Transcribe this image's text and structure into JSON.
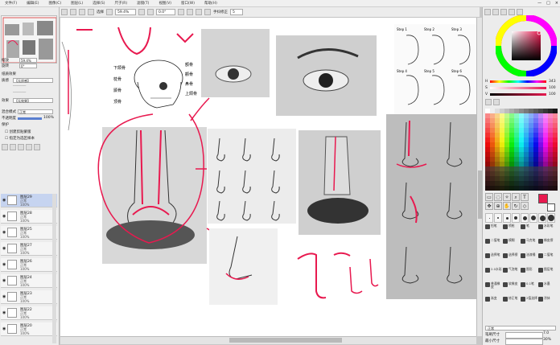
{
  "menu": [
    "文件(F)",
    "编辑(E)",
    "图像(C)",
    "图层(L)",
    "选择(S)",
    "尺子(R)",
    "滤镜(T)",
    "视图(V)",
    "窗口(W)",
    "帮助(H)"
  ],
  "window_controls": [
    "—",
    "□",
    "×"
  ],
  "toolbar": {
    "select_label": "选择",
    "zoom_value": "59.4%",
    "angle_value": "0.0°",
    "stabilizer_label": "手抖修正",
    "stabilizer_value": "5"
  },
  "navigator": {
    "zoom_label": "缩放",
    "zoom_value": "59.4%",
    "rotate_label": "旋转",
    "rotate_value": "0°"
  },
  "layer_props": {
    "section_label": "纸质效果",
    "texture_label": "质感",
    "texture_value": "【无质感】",
    "effect_label": "效果",
    "effect_value": "【无效果】",
    "blend_label": "混合模式",
    "blend_value": "正常",
    "opacity_label": "不透明度",
    "opacity_value": "100%",
    "protect_label": "保护",
    "clip_label": "创建剪贴蒙版",
    "ref_label": "指定为选区样本"
  },
  "layers": [
    {
      "name": "图层29",
      "mode": "正常",
      "opacity": "100%",
      "selected": true
    },
    {
      "name": "图层28",
      "mode": "正常",
      "opacity": "100%",
      "selected": false
    },
    {
      "name": "图层25",
      "mode": "正常",
      "opacity": "100%",
      "selected": false
    },
    {
      "name": "图层27",
      "mode": "正常",
      "opacity": "100%",
      "selected": false
    },
    {
      "name": "图层26",
      "mode": "正常",
      "opacity": "100%",
      "selected": false
    },
    {
      "name": "图层24",
      "mode": "正常",
      "opacity": "100%",
      "selected": false
    },
    {
      "name": "图层23",
      "mode": "正常",
      "opacity": "100%",
      "selected": false
    },
    {
      "name": "图层22",
      "mode": "正常",
      "opacity": "100%",
      "selected": false
    },
    {
      "name": "图层20",
      "mode": "正常",
      "opacity": "100%",
      "selected": false
    }
  ],
  "color": {
    "h_label": "H",
    "h_value": "343",
    "s_label": "S",
    "s_value": "100",
    "v_label": "V",
    "v_value": "100",
    "main_color": "#e8194f",
    "secondary_color": "#ffffff"
  },
  "brush_sizes": [
    "0.5",
    "1",
    "2",
    "3",
    "4",
    "5",
    "7",
    "10"
  ],
  "brush_tools": [
    "铅笔",
    "喷枪",
    "笔",
    "水彩笔",
    "二值笔",
    "模糊",
    "马克笔",
    "橡皮擦",
    "选择笔",
    "选择擦",
    "油漆桶",
    "二值笔",
    "2.0水彩",
    "气泡笔",
    "图形",
    "图层笔",
    "普通橡皮",
    "软橡皮",
    "0.1笔",
    "水墨",
    "渐变",
    "修正笔",
    "2值选择",
    "涂抹"
  ],
  "brush_props": {
    "blend_label": "正常",
    "size_label": "笔刷尺寸",
    "size_value": "7.0",
    "min_size_label": "最小尺寸",
    "min_size_value": "30%"
  },
  "canvas_text": {
    "ear_steps": [
      "Step 1",
      "Step 2",
      "Step 3",
      "Step 4",
      "Step 5",
      "Step 6"
    ],
    "skull_labels": [
      "额骨",
      "颧骨",
      "鼻骨",
      "上颌骨",
      "下颌骨",
      "枕骨",
      "颞骨",
      "顶骨"
    ]
  }
}
